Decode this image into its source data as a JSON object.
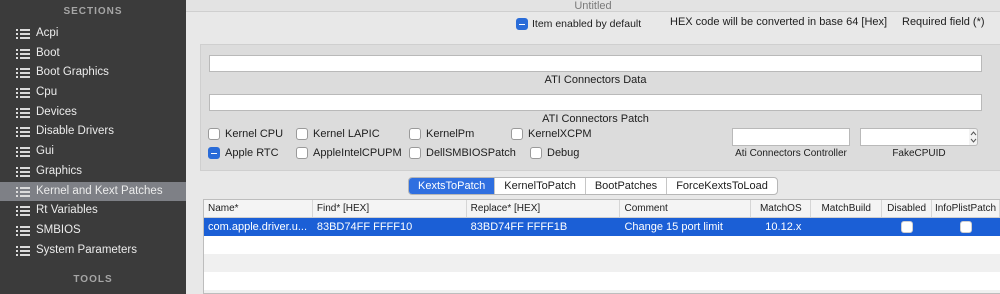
{
  "window": {
    "title": "Untitled"
  },
  "sidebar": {
    "section_heading": "SECTIONS",
    "items": [
      {
        "label": "Acpi",
        "selected": false
      },
      {
        "label": "Boot",
        "selected": false
      },
      {
        "label": "Boot Graphics",
        "selected": false
      },
      {
        "label": "Cpu",
        "selected": false
      },
      {
        "label": "Devices",
        "selected": false
      },
      {
        "label": "Disable Drivers",
        "selected": false
      },
      {
        "label": "Gui",
        "selected": false
      },
      {
        "label": "Graphics",
        "selected": false
      },
      {
        "label": "Kernel and Kext Patches",
        "selected": true
      },
      {
        "label": "Rt Variables",
        "selected": false
      },
      {
        "label": "SMBIOS",
        "selected": false
      },
      {
        "label": "System Parameters",
        "selected": false
      }
    ],
    "tools_heading": "TOOLS"
  },
  "legend": {
    "item_enabled_label": "Item enabled by default",
    "hex_note": "HEX code will be converted in base 64 [Hex]",
    "required_note": "Required field (*)"
  },
  "fields": {
    "ati_connectors_data": {
      "label": "ATI Connectors Data",
      "value": ""
    },
    "ati_connectors_patch": {
      "label": "ATI Connectors Patch",
      "value": ""
    },
    "ati_connectors_controller": {
      "label": "Ati Connectors Controller",
      "value": ""
    },
    "fake_cpuid": {
      "label": "FakeCPUID",
      "value": ""
    }
  },
  "checkboxes": {
    "kernel_cpu": {
      "label": "Kernel CPU",
      "checked": false
    },
    "kernel_lapic": {
      "label": "Kernel LAPIC",
      "checked": false
    },
    "kernel_pm": {
      "label": "KernelPm",
      "checked": false
    },
    "kernel_xcpm": {
      "label": "KernelXCPM",
      "checked": false
    },
    "apple_rtc": {
      "label": "Apple RTC",
      "checked": true
    },
    "apple_intel_cpupm": {
      "label": "AppleIntelCPUPM",
      "checked": false
    },
    "dell_smbios_patch": {
      "label": "DellSMBIOSPatch",
      "checked": false
    },
    "debug": {
      "label": "Debug",
      "checked": false
    }
  },
  "tabs": [
    {
      "label": "KextsToPatch",
      "active": true
    },
    {
      "label": "KernelToPatch",
      "active": false
    },
    {
      "label": "BootPatches",
      "active": false
    },
    {
      "label": "ForceKextsToLoad",
      "active": false
    }
  ],
  "table": {
    "columns": [
      "Name*",
      "Find* [HEX]",
      "Replace* [HEX]",
      "Comment",
      "MatchOS",
      "MatchBuild",
      "Disabled",
      "InfoPlistPatch"
    ],
    "rows": [
      {
        "name": "com.apple.driver.u...",
        "find": "83BD74FF FFFF10",
        "replace": "83BD74FF FFFF1B",
        "comment": "Change 15 port limit",
        "match_os": "10.12.x",
        "match_build": "",
        "disabled": false,
        "info_plist_patch": false
      }
    ]
  },
  "colors": {
    "accent": "#2f6fe0",
    "selected_row": "#1b5fd6",
    "sidebar_bg": "#3b3b3b",
    "sidebar_selected": "#7e8086"
  },
  "icons": {
    "sidebar_item_icon": "list-icon",
    "stepper_icon": "up-down-stepper-icon"
  }
}
